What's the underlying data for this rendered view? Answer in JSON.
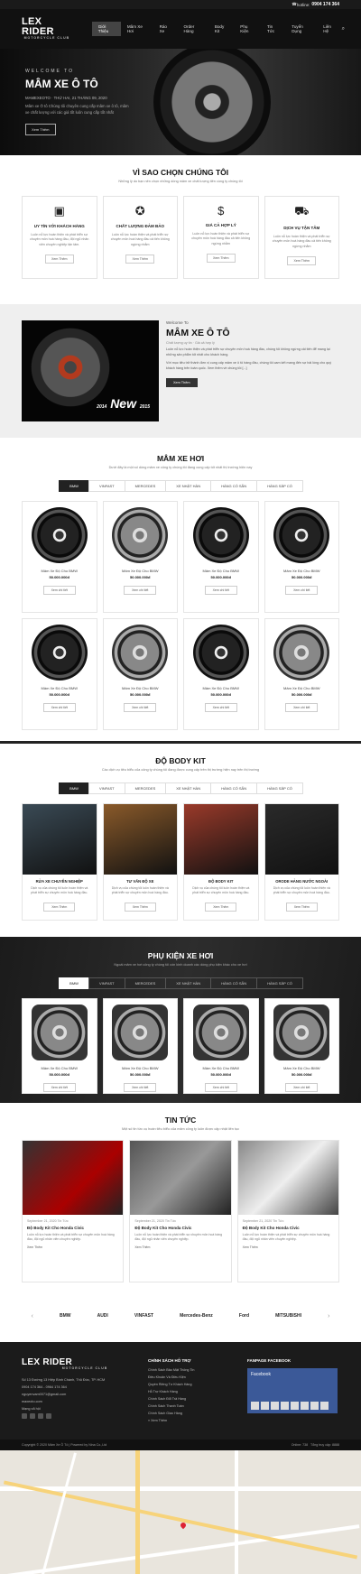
{
  "topbar": {
    "hotline_label": "hotline:",
    "hotline": "0904 174 364"
  },
  "nav": {
    "logo": "LEX RIDER",
    "logo_sub": "MOTORCYCLE CLUB",
    "items": [
      "Giới Thiệu",
      "Mâm Xe Hơi",
      "Ráo Xe",
      "Order Hàng",
      "Body Kit",
      "Phụ Kiện",
      "Tin Tức",
      "Tuyển Dụng",
      "Liên Hệ"
    ],
    "active": 0
  },
  "hero": {
    "welcome": "WELCOME TO",
    "title": "MÂM XE Ô TÔ",
    "date": "MAMEXEOTO · THỨ HAI, 21 THÁNG 09, 2020",
    "desc": "Mâm xe Ô tô Chúng tôi chuyên cung cấp mâm xe ô tô, mâm xe chất lượng với các giá tốt luôn cung cấp tốt nhất",
    "button": "Xem Thêm"
  },
  "why": {
    "title": "VÌ SAO CHỌN CHÚNG TÔI",
    "subtitle": "Những lý do bạn nên chọn những dòng mâm xe chất lượng tiên cùng ty chúng tôi",
    "items": [
      {
        "icon": "box-icon",
        "title": "UY TÍN VỚI KHÁCH HÀNG",
        "desc": "Luôn nỗ lực hoàn thiện và phát triển sự chuyên môn hoá hàng đầu, đội ngũ nhân viên chuyên nghiệp tận tâm.",
        "btn": "Xem Thêm"
      },
      {
        "icon": "medal-icon",
        "title": "CHẤT LƯỢNG ĐẢM BẢO",
        "desc": "Luôn nỗ lực hoàn thiện và phát triển sự chuyên môn hoá hàng đầu cả tiến không ngừng nhằm",
        "btn": "Xem Thêm"
      },
      {
        "icon": "dollar-icon",
        "title": "GIÁ CẢ HỢP LÝ",
        "desc": "Luôn nỗ lực hoàn thiện và phát triển sự chuyên môn hoá hàng đầu cả tiến không ngừng nhằm",
        "btn": "Xem Thêm"
      },
      {
        "icon": "truck-icon",
        "title": "DỊCH VỤ TẬN TÂM",
        "desc": "Luôn nỗ lực hoàn thiện và phát triển sự chuyên môn hoá hàng đầu cả tiến không ngừng nhằm",
        "btn": "Xem Thêm"
      }
    ]
  },
  "about": {
    "welcome": "Welcome To",
    "title": "MÂM XE Ô TÔ",
    "tag": "Chất lượng uy tín · Giá cả hợp lý",
    "para1": "Luôn nỗ lực hoàn thiện và phát triển sự chuyên môn hoá hàng đầu, chúng tôi không ngừng cải tiến để mang lại những sản phẩm tốt nhất cho khách hàng.",
    "para2": "Với mục tiêu trở thành đơn vị cung cấp mâm xe ô tô hàng đầu, chúng tôi cam kết mang đến sự hài lòng cho quý khách hàng trên toàn quốc. Xem thêm về chúng tôi [...]",
    "button": "Xem Thêm",
    "img_text": "New",
    "img_year_left": "2014",
    "img_year_right": "2015"
  },
  "wheels": {
    "title": "MÂM XE HƠI",
    "subtitle": "Dưới đây là một số dòng mâm xe công ty chúng tôi đang cung cấp tốt nhất thị trường hiện nay",
    "tabs": [
      "BMW",
      "VINFAST",
      "MERCEDES",
      "XE NHẬT HÀN",
      "HÀNG CÓ SẴN",
      "HÀNG SẮP CÓ"
    ],
    "products": [
      {
        "name": "Mâm Xe Độ Cho BMW",
        "price": "50.000.000đ",
        "btn": "Xem chi tiết",
        "style": "dark"
      },
      {
        "name": "Mâm Xe Độ Cho BMW",
        "price": "50.000.000đ",
        "btn": "Xem chi tiết",
        "style": "silver"
      },
      {
        "name": "Mâm Xe Độ Cho BMW",
        "price": "50.000.000đ",
        "btn": "Xem chi tiết",
        "style": "dark"
      },
      {
        "name": "Mâm Xe Độ Cho BMW",
        "price": "50.000.000đ",
        "btn": "Xem chi tiết",
        "style": "dark"
      },
      {
        "name": "Mâm Xe Độ Cho BMW",
        "price": "50.000.000đ",
        "btn": "Xem chi tiết",
        "style": "dark"
      },
      {
        "name": "Mâm Xe Độ Cho BMW",
        "price": "50.000.000đ",
        "btn": "Xem chi tiết",
        "style": "silver"
      },
      {
        "name": "Mâm Xe Độ Cho BMW",
        "price": "50.000.000đ",
        "btn": "Xem chi tiết",
        "style": "dark"
      },
      {
        "name": "Mâm Xe Độ Cho BMW",
        "price": "50.000.000đ",
        "btn": "Xem chi tiết",
        "style": "silver"
      }
    ]
  },
  "kit": {
    "title": "ĐỘ BODY KIT",
    "subtitle": "Các dịch vụ tiêu biểu của công ty chúng tôi đang được cung cấp trên thị trường hiện nay trên thị trường",
    "tabs": [
      "BMW",
      "VINFAST",
      "MERCEDES",
      "XE NHẬT HÀN",
      "HÀNG CÓ SẴN",
      "HÀNG SẮP CÓ"
    ],
    "items": [
      {
        "title": "RỬA XE CHUYÊN NGHIỆP",
        "desc": "Dịch vụ của chúng tôi luôn hoàn thiện và phát triển sự chuyên môn hoá hàng đầu.",
        "btn": "Xem Thêm",
        "color": "#3a4a55"
      },
      {
        "title": "TƯ VẤN ĐỘ XE",
        "desc": "Dịch vụ của chúng tôi luôn hoàn thiện và phát triển sự chuyên môn hoá hàng đầu.",
        "btn": "Xem Thêm",
        "color": "#8a5a2a"
      },
      {
        "title": "ĐỘ BODY KIT",
        "desc": "Dịch vụ của chúng tôi luôn hoàn thiện và phát triển sự chuyên môn hoá hàng đầu.",
        "btn": "Xem Thêm",
        "color": "#9a3a2a"
      },
      {
        "title": "ORODE HẢNG NƯỚC NGOÀI",
        "desc": "Dịch vụ của chúng tôi luôn hoàn thiện và phát triển sự chuyên môn hoá hàng đầu.",
        "btn": "Xem Thêm",
        "color": "#2a2a2a"
      }
    ]
  },
  "accessories": {
    "title": "PHỤ KIỆN XE HƠI",
    "subtitle": "Ngoài mâm xe hơi công ty chúng tôi còn kinh doanh các dòng phụ kiện khác cho xe hơi",
    "tabs": [
      "BMW",
      "VINFAST",
      "MERCEDES",
      "XE NHẬT HÀN",
      "HÀNG CÓ SẴN",
      "HÀNG SẮP CÓ"
    ],
    "products": [
      {
        "name": "Mâm Xe Độ Cho BMW",
        "price": "50.000.000đ",
        "btn": "Xem chi tiết"
      },
      {
        "name": "Mâm Xe Độ Cho BMW",
        "price": "50.000.000đ",
        "btn": "Xem chi tiết"
      },
      {
        "name": "Mâm Xe Độ Cho BMW",
        "price": "50.000.000đ",
        "btn": "Xem chi tiết"
      },
      {
        "name": "Mâm Xe Độ Cho BMW",
        "price": "50.000.000đ",
        "btn": "Xem chi tiết"
      }
    ]
  },
  "news": {
    "title": "TIN TỨC",
    "subtitle": "Một số tin tức cụ hoàn tiêu biểu của mâm công ty luôn được cập nhật liên tục",
    "items": [
      {
        "date": "September 21, 2020",
        "cat": "Tin Tức",
        "title": "Độ Body Kit Cho Honda Civic",
        "desc": "Luôn nỗ lực hoàn thiện và phát triển sự chuyên môn hoá hàng đầu, đội ngũ nhân viên chuyên nghiệp.",
        "more": "Xem Thêm"
      },
      {
        "date": "September 21, 2020",
        "cat": "Tin Tức",
        "title": "Độ Body Kit Cho Honda Civic",
        "desc": "Luôn nỗ lực hoàn thiện và phát triển sự chuyên môn hoá hàng đầu, đội ngũ nhân viên chuyên nghiệp.",
        "more": "Xem Thêm"
      },
      {
        "date": "September 21, 2020",
        "cat": "Tin Tức",
        "title": "Độ Body Kit Cho Honda Civic",
        "desc": "Luôn nỗ lực hoàn thiện và phát triển sự chuyên môn hoá hàng đầu, đội ngũ nhân viên chuyên nghiệp.",
        "more": "Xem Thêm"
      }
    ]
  },
  "brands": [
    "BMW",
    "AUDI",
    "VINFAST",
    "Mercedes-Benz",
    "Ford",
    "MITSUBISHI"
  ],
  "footer": {
    "logo": "LEX RIDER",
    "logo_sub": "MOTORCYCLE CLUB",
    "address": "Số 13 Đường 13 Hiệp Bình Chánh, Thủ Đức, TP. HCM",
    "phone": "0904 174 364 - 0964 174 364",
    "email": "nguyenvam0071@gmail.com",
    "web": "maxeoto.com",
    "social_label": "Mạng xã hội",
    "policy_title": "CHÍNH SÁCH HỖ TRỢ",
    "policies": [
      "Chính Sách Bảo Mật Thông Tin",
      "Điều Khoản Và Điều Kiện",
      "Quyền Riêng Tư Khách Hàng",
      "Hỗ Trợ Khách Hàng",
      "Chính Sách Đổi Trả Hàng",
      "Chính Sách Thanh Toán",
      "Chính Sách Giao Hàng",
      "» Xem Thêm"
    ],
    "fb_title": "FANPAGE FACEBOOK",
    "fb_name": "Facebook"
  },
  "copyright": {
    "left": "Copyright © 2020 Mâm Xe Ô Tô | Powered by Nina Co.,Ltd",
    "online": "Online: 738",
    "total": "Tổng truy cập: 8888"
  }
}
